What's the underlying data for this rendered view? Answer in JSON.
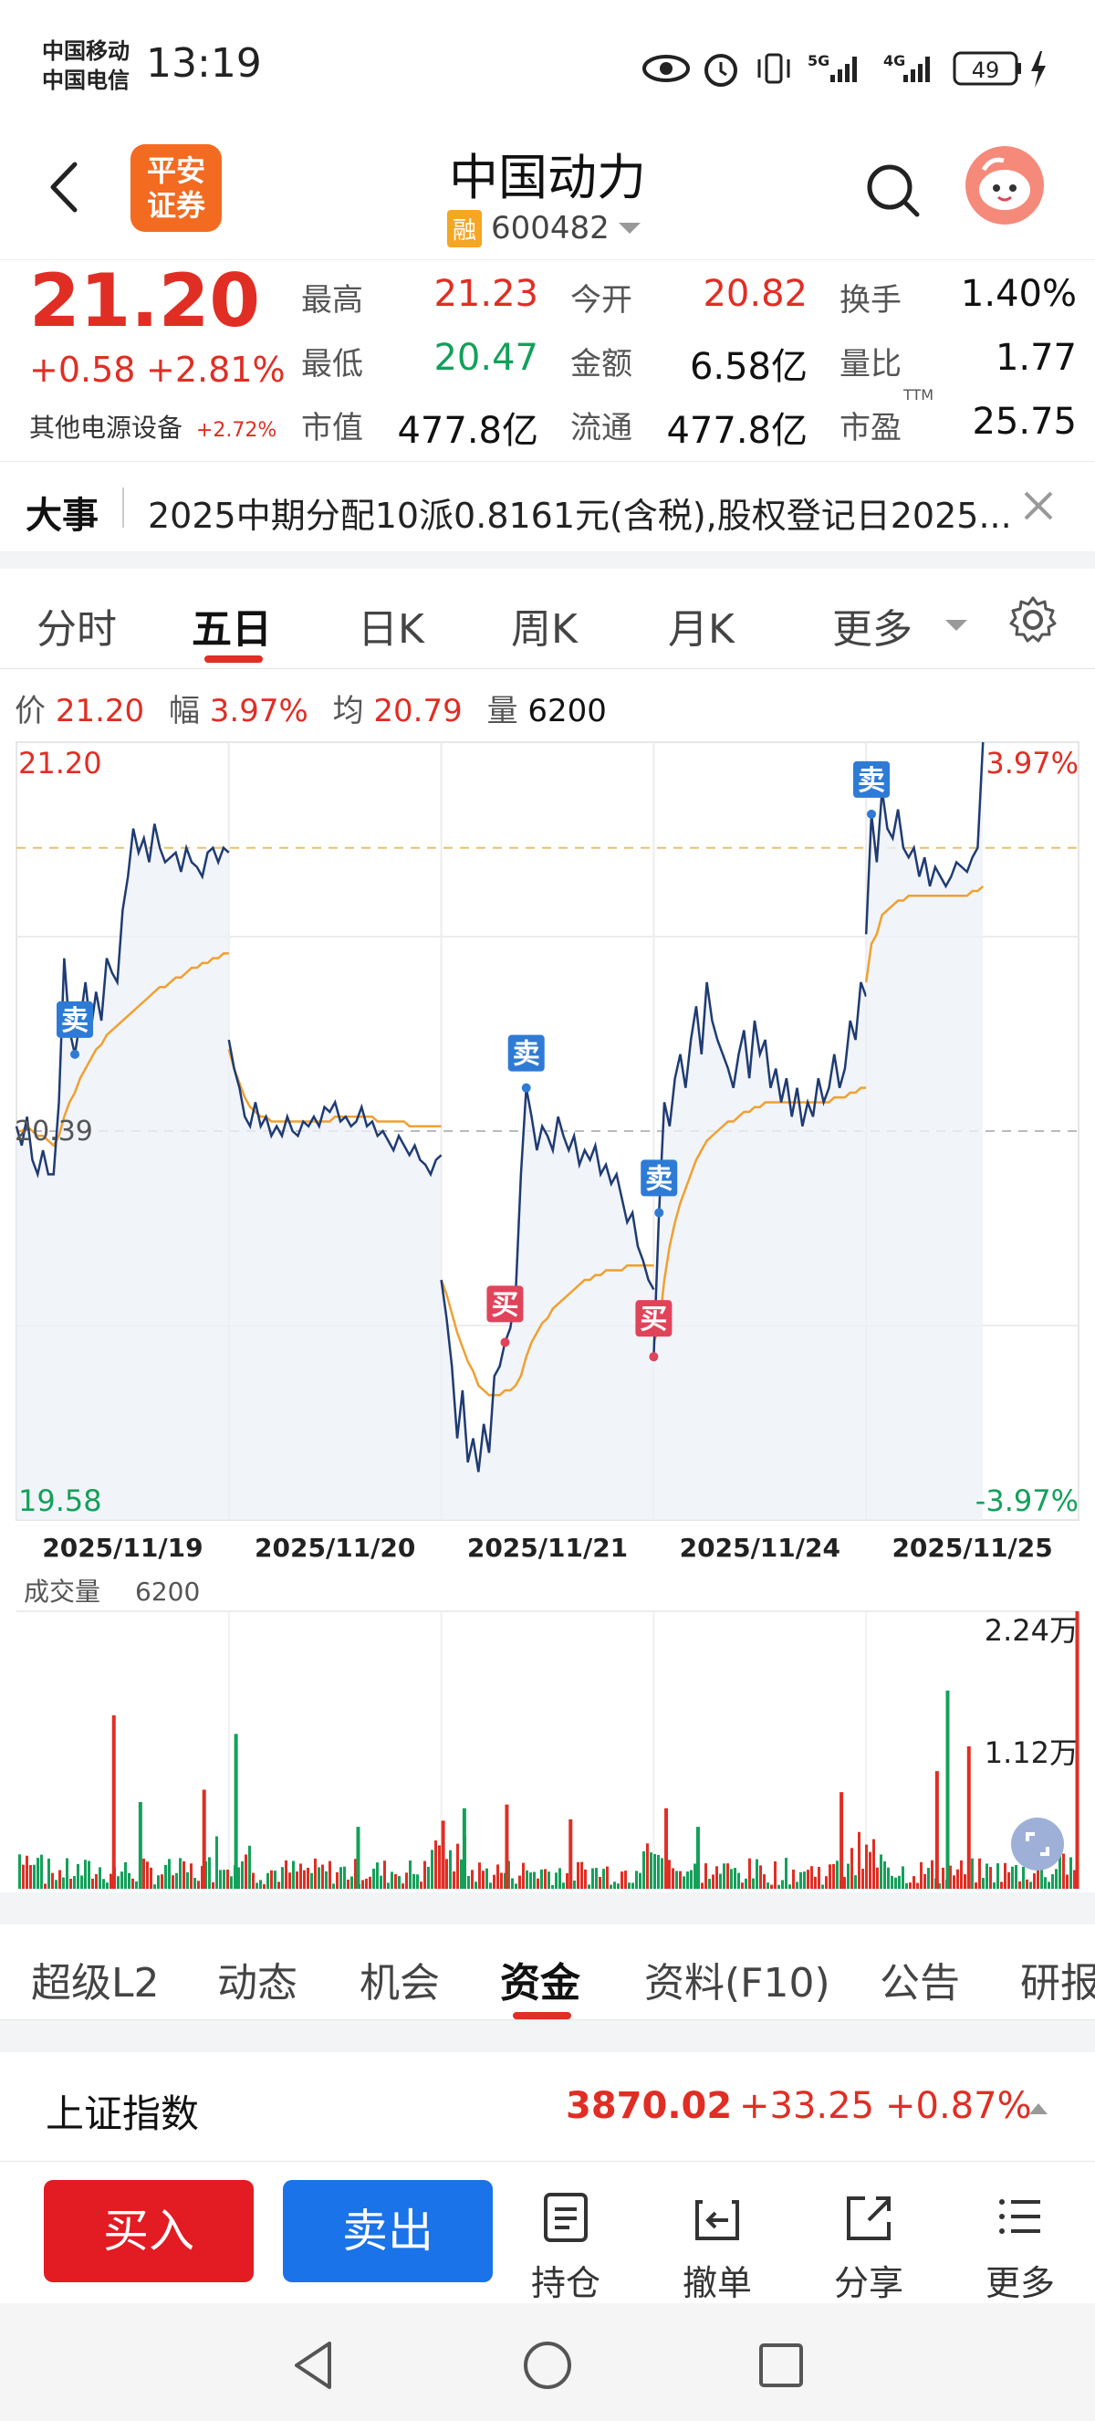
{
  "status_bar": {
    "carrier1": "中国移动",
    "carrier2": "中国电信",
    "time": "13:19",
    "signal1": "5G",
    "signal2": "4G",
    "battery": "49"
  },
  "header": {
    "broker_logo_line1": "平安",
    "broker_logo_line2": "证券",
    "stock_name": "中国动力",
    "margin_badge": "融",
    "stock_code": "600482"
  },
  "quote": {
    "price": "21.20",
    "change": "+0.58",
    "change_pct": "+2.81%",
    "sector": "其他电源设备",
    "sector_pct": "+2.72%",
    "rows": [
      [
        {
          "label": "最高",
          "value": "21.23",
          "color": "red"
        },
        {
          "label": "今开",
          "value": "20.82",
          "color": "red"
        },
        {
          "label": "换手",
          "value": "1.40%",
          "color": "black"
        }
      ],
      [
        {
          "label": "最低",
          "value": "20.47",
          "color": "green"
        },
        {
          "label": "金额",
          "value": "6.58亿",
          "color": "black"
        },
        {
          "label": "量比",
          "value": "1.77",
          "color": "black"
        }
      ],
      [
        {
          "label": "市值",
          "value": "477.8亿",
          "color": "black"
        },
        {
          "label": "流通",
          "value": "477.8亿",
          "color": "black"
        },
        {
          "label": "市盈",
          "value": "25.75",
          "color": "black",
          "sup": "TTM"
        }
      ]
    ]
  },
  "event": {
    "title": "大事",
    "text": "2025中期分配10派0.8161元(含税),股权登记日2025..."
  },
  "period_tabs": [
    "分时",
    "五日",
    "日K",
    "周K",
    "月K",
    "更多"
  ],
  "active_period": "五日",
  "info_line": {
    "price_label": "价",
    "price": "21.20",
    "amp_label": "幅",
    "amp": "3.97%",
    "avg_label": "均",
    "avg": "20.79",
    "vol_label": "量",
    "vol": "6200"
  },
  "colors": {
    "red": "#e02e24",
    "green": "#14a05a",
    "price_line": "#1f3b73",
    "avg_line": "#f0a030",
    "marker_sell": "#2e7bd6",
    "marker_buy": "#e0445a",
    "buy_button": "#e31b23",
    "sell_button": "#1a73e8"
  },
  "chart_data": {
    "type": "line",
    "days": [
      "2025/11/19",
      "2025/11/20",
      "2025/11/21",
      "2025/11/24",
      "2025/11/25"
    ],
    "ylim": [
      19.58,
      21.2
    ],
    "y_top_label": "21.20",
    "y_bottom_label": "19.58",
    "pct_top_label": "3.97%",
    "pct_bottom_label": "-3.97%",
    "prev_close": 20.39,
    "prev_close_label": "20.39",
    "series": [
      {
        "values": [
          20.4,
          20.36,
          20.42,
          20.33,
          20.3,
          20.35,
          20.3,
          20.3,
          20.45,
          20.75,
          20.6,
          20.55,
          20.62,
          20.7,
          20.6,
          20.68,
          20.62,
          20.75,
          20.72,
          20.7,
          20.85,
          20.92,
          21.02,
          20.97,
          21.0,
          20.95,
          21.03,
          20.98,
          20.95,
          20.96,
          20.97,
          20.93,
          20.98,
          20.95,
          20.94,
          20.92,
          20.97,
          20.98,
          20.95,
          20.98,
          20.97
        ]
      },
      {
        "values": [
          20.58,
          20.52,
          20.48,
          20.42,
          20.4,
          20.45,
          20.4,
          20.42,
          20.38,
          20.4,
          20.38,
          20.42,
          20.39,
          20.38,
          20.41,
          20.4,
          20.42,
          20.4,
          20.44,
          20.43,
          20.45,
          20.41,
          20.42,
          20.4,
          20.41,
          20.44,
          20.4,
          20.41,
          20.38,
          20.39,
          20.37,
          20.35,
          20.38,
          20.36,
          20.34,
          20.36,
          20.33,
          20.32,
          20.3,
          20.33,
          20.34
        ]
      },
      {
        "values": [
          20.08,
          20.0,
          19.9,
          19.75,
          19.85,
          19.7,
          19.75,
          19.68,
          19.78,
          19.72,
          19.88,
          19.9,
          19.95,
          19.98,
          20.05,
          20.3,
          20.48,
          20.42,
          20.35,
          20.4,
          20.38,
          20.35,
          20.42,
          20.38,
          20.35,
          20.38,
          20.32,
          20.35,
          20.33,
          20.36,
          20.3,
          20.32,
          20.28,
          20.3,
          20.25,
          20.2,
          20.22,
          20.15,
          20.12,
          20.08,
          20.06
        ]
      },
      {
        "values": [
          19.92,
          20.22,
          20.45,
          20.4,
          20.5,
          20.55,
          20.48,
          20.58,
          20.65,
          20.55,
          20.7,
          20.62,
          20.58,
          20.55,
          20.52,
          20.48,
          20.55,
          20.6,
          20.5,
          20.62,
          20.55,
          20.58,
          20.48,
          20.52,
          20.45,
          20.5,
          20.42,
          20.48,
          20.4,
          20.45,
          20.42,
          20.5,
          20.45,
          20.48,
          20.55,
          20.48,
          20.52,
          20.62,
          20.58,
          20.7,
          20.67
        ]
      },
      {
        "values": [
          20.8,
          21.05,
          20.95,
          21.1,
          21.02,
          21.0,
          21.06,
          20.98,
          20.96,
          20.98,
          20.92,
          20.96,
          20.9,
          20.94,
          20.92,
          20.9,
          20.92,
          20.95,
          20.94,
          20.93,
          20.96,
          20.98,
          21.2
        ]
      }
    ],
    "avg_series": [
      {
        "values": [
          20.39,
          20.39,
          20.4,
          20.39,
          20.38,
          20.38,
          20.37,
          20.36,
          20.38,
          20.42,
          20.45,
          20.47,
          20.5,
          20.52,
          20.54,
          20.56,
          20.57,
          20.59,
          20.6,
          20.61,
          20.62,
          20.63,
          20.64,
          20.65,
          20.66,
          20.67,
          20.68,
          20.69,
          20.69,
          20.7,
          20.71,
          20.71,
          20.72,
          20.73,
          20.73,
          20.74,
          20.74,
          20.75,
          20.75,
          20.76,
          20.76
        ]
      },
      {
        "values": [
          20.56,
          20.52,
          20.49,
          20.46,
          20.44,
          20.43,
          20.42,
          20.42,
          20.41,
          20.41,
          20.41,
          20.41,
          20.41,
          20.41,
          20.41,
          20.41,
          20.41,
          20.41,
          20.41,
          20.41,
          20.42,
          20.42,
          20.42,
          20.42,
          20.42,
          20.42,
          20.42,
          20.42,
          20.41,
          20.41,
          20.41,
          20.41,
          20.41,
          20.41,
          20.4,
          20.4,
          20.4,
          20.4,
          20.4,
          20.4,
          20.4
        ]
      },
      {
        "values": [
          20.08,
          20.05,
          20.01,
          19.97,
          19.94,
          19.91,
          19.89,
          19.86,
          19.85,
          19.84,
          19.84,
          19.84,
          19.85,
          19.85,
          19.86,
          19.88,
          19.92,
          19.95,
          19.97,
          19.99,
          20.0,
          20.02,
          20.03,
          20.04,
          20.05,
          20.06,
          20.07,
          20.08,
          20.08,
          20.09,
          20.09,
          20.1,
          20.1,
          20.1,
          20.1,
          20.11,
          20.11,
          20.11,
          20.11,
          20.11,
          20.11
        ]
      },
      {
        "values": [
          19.95,
          19.98,
          20.08,
          20.15,
          20.2,
          20.24,
          20.27,
          20.3,
          20.33,
          20.35,
          20.37,
          20.38,
          20.39,
          20.4,
          20.41,
          20.41,
          20.42,
          20.43,
          20.43,
          20.44,
          20.44,
          20.45,
          20.45,
          20.45,
          20.45,
          20.45,
          20.45,
          20.45,
          20.45,
          20.45,
          20.45,
          20.45,
          20.45,
          20.45,
          20.46,
          20.46,
          20.46,
          20.47,
          20.47,
          20.48,
          20.48
        ]
      },
      {
        "values": [
          20.7,
          20.78,
          20.8,
          20.84,
          20.85,
          20.86,
          20.87,
          20.87,
          20.88,
          20.88,
          20.88,
          20.88,
          20.88,
          20.88,
          20.88,
          20.88,
          20.88,
          20.88,
          20.88,
          20.88,
          20.89,
          20.89,
          20.9
        ]
      }
    ],
    "markers": [
      {
        "label": "卖",
        "type": "sell",
        "day": 0,
        "index": 11
      },
      {
        "label": "买",
        "type": "buy",
        "day": 2,
        "index": 12
      },
      {
        "label": "卖",
        "type": "sell",
        "day": 2,
        "index": 16
      },
      {
        "label": "卖",
        "type": "sell",
        "day": 3,
        "index": 1
      },
      {
        "label": "买",
        "type": "buy",
        "day": 3,
        "index": 0
      },
      {
        "label": "卖",
        "type": "sell",
        "day": 4,
        "index": 1
      }
    ],
    "grid": true
  },
  "volume": {
    "label": "成交量",
    "value": "6200",
    "top_label": "2.24万",
    "mid_label": "1.12万",
    "ylim": [
      0,
      22400
    ],
    "spikes": [
      {
        "x_frac": 0.09,
        "v": 14000,
        "c": "red"
      },
      {
        "x_frac": 0.115,
        "v": 7000,
        "c": "green"
      },
      {
        "x_frac": 0.175,
        "v": 8000,
        "c": "red"
      },
      {
        "x_frac": 0.205,
        "v": 12500,
        "c": "green"
      },
      {
        "x_frac": 0.32,
        "v": 5000,
        "c": "green"
      },
      {
        "x_frac": 0.4,
        "v": 5500,
        "c": "red"
      },
      {
        "x_frac": 0.42,
        "v": 6500,
        "c": "green"
      },
      {
        "x_frac": 0.46,
        "v": 6800,
        "c": "red"
      },
      {
        "x_frac": 0.52,
        "v": 5600,
        "c": "red"
      },
      {
        "x_frac": 0.61,
        "v": 6500,
        "c": "red"
      },
      {
        "x_frac": 0.64,
        "v": 5000,
        "c": "green"
      },
      {
        "x_frac": 0.775,
        "v": 7800,
        "c": "red"
      },
      {
        "x_frac": 0.865,
        "v": 9500,
        "c": "red"
      },
      {
        "x_frac": 0.875,
        "v": 16000,
        "c": "green"
      },
      {
        "x_frac": 0.895,
        "v": 11500,
        "c": "red"
      },
      {
        "x_frac": 0.997,
        "v": 22400,
        "c": "red"
      }
    ]
  },
  "section_tabs": [
    "超级L2",
    "动态",
    "机会",
    "资金",
    "资料(F10)",
    "公告",
    "研报"
  ],
  "active_section_tab": "资金",
  "index_bar": {
    "name": "上证指数",
    "value": "3870.02",
    "change": "+33.25",
    "change_pct": "+0.87%"
  },
  "bottom_bar": {
    "buy": "买入",
    "sell": "卖出",
    "position": "持仓",
    "cancel": "撤单",
    "share": "分享",
    "more": "更多"
  }
}
